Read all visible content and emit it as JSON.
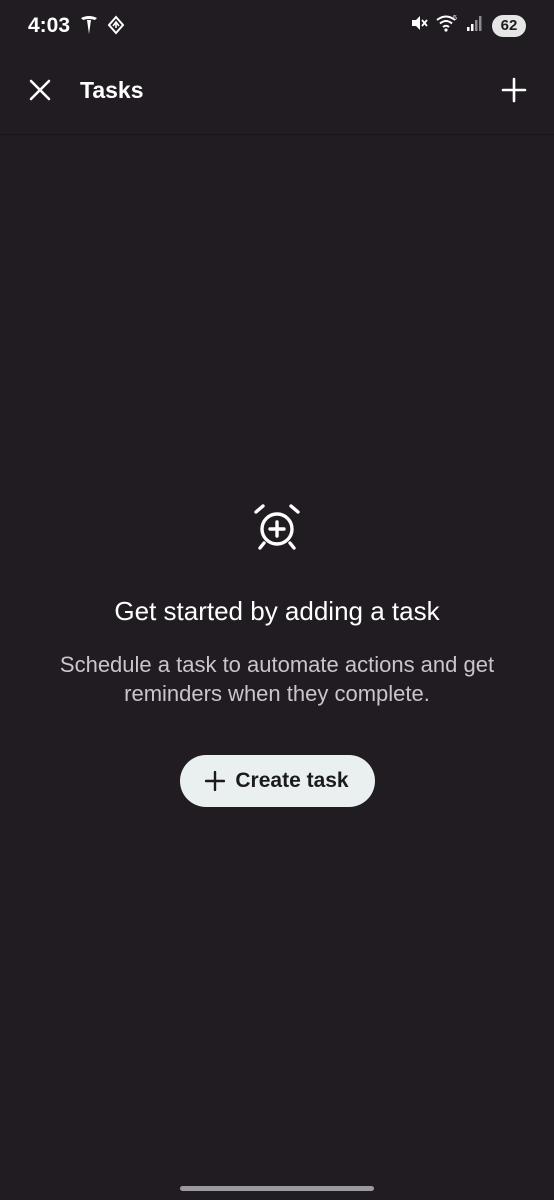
{
  "status_bar": {
    "time": "4:03",
    "battery": "62",
    "icons": [
      "tesla-icon",
      "diamond-nav-icon",
      "mute-icon",
      "wifi-icon",
      "signal-icon"
    ]
  },
  "app_bar": {
    "title": "Tasks",
    "close_icon": "close-icon",
    "add_icon": "plus-icon"
  },
  "empty_state": {
    "icon": "alarm-add-icon",
    "title": "Get started by adding a task",
    "description": "Schedule a task to automate actions and get reminders when they complete.",
    "button_label": "Create task"
  },
  "colors": {
    "background": "#201c21",
    "button_bg": "#eaf0ef",
    "text_primary": "#ffffff",
    "text_secondary": "#c9c5cc"
  }
}
